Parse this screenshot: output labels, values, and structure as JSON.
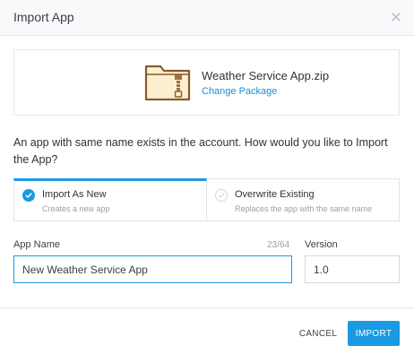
{
  "dialog": {
    "title": "Import App",
    "close_icon": "close-icon"
  },
  "package": {
    "icon": "zip-folder-icon",
    "file_name": "Weather Service App.zip",
    "change_label": "Change Package"
  },
  "question": "An app with same name exists in the account. How would you like to Import the App?",
  "options": [
    {
      "title": "Import As New",
      "description": "Creates a new app",
      "selected": true
    },
    {
      "title": "Overwrite Existing",
      "description": "Replaces the app with the same name",
      "selected": false
    }
  ],
  "form": {
    "app_name_label": "App Name",
    "app_name_counter": "23/64",
    "app_name_value": "New Weather Service App",
    "version_label": "Version",
    "version_value": "1.0"
  },
  "buttons": {
    "cancel": "CANCEL",
    "import": "IMPORT"
  },
  "colors": {
    "accent": "#1a9ae2",
    "folder_fill": "#fcefcf",
    "folder_stroke": "#8a5a2b",
    "header_bg": "#f8f9fa"
  }
}
